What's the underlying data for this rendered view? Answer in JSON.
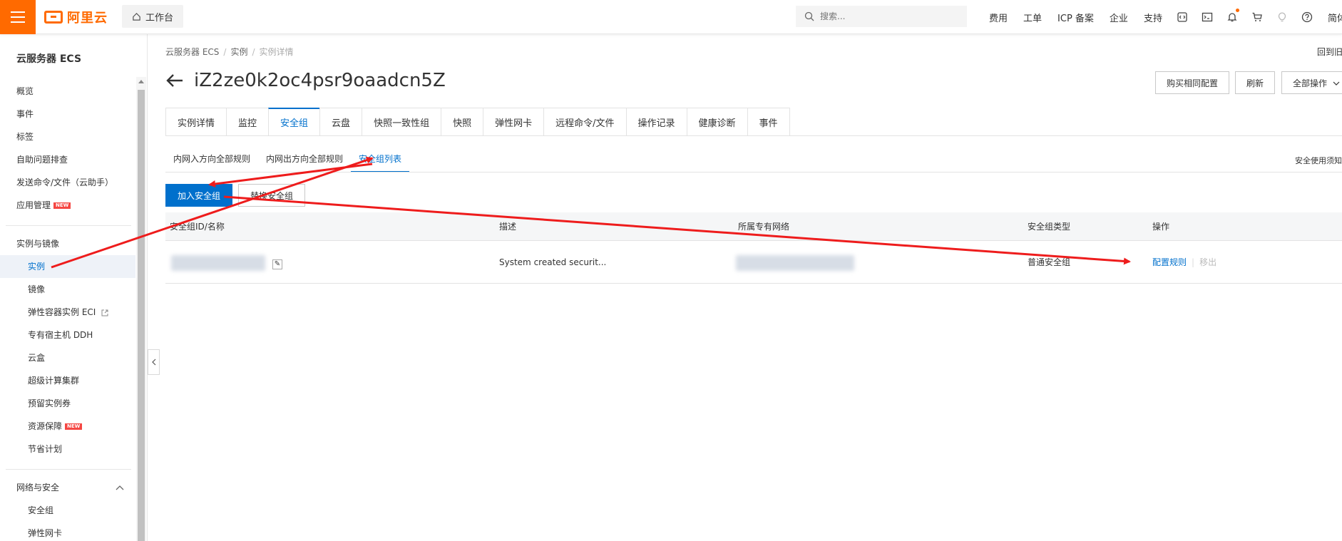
{
  "topbar": {
    "logo_text": "阿里云",
    "workbench": "工作台",
    "search_placeholder": "搜索...",
    "nav": [
      "费用",
      "工单",
      "ICP 备案",
      "企业",
      "支持"
    ],
    "icons": [
      "code-icon",
      "terminal-icon",
      "bell-icon",
      "cart-icon",
      "lightbulb-icon",
      "help-icon"
    ],
    "language": "简体"
  },
  "sidebar": {
    "title": "云服务器 ECS",
    "items": [
      "概览",
      "事件",
      "标签",
      "自助问题排查",
      "发送命令/文件（云助手）",
      "应用管理"
    ],
    "new_badge": "NEW",
    "group1": {
      "label": "实例与镜像",
      "items": [
        "实例",
        "镜像",
        "弹性容器实例 ECI",
        "专有宿主机 DDH",
        "云盒",
        "超级计算集群",
        "预留实例券",
        "资源保障",
        "节省计划"
      ]
    },
    "group2": {
      "label": "网络与安全",
      "items": [
        "安全组",
        "弹性网卡"
      ]
    }
  },
  "breadcrumb": [
    "云服务器 ECS",
    "实例",
    "实例详情"
  ],
  "back_link": "回到旧",
  "page_title": "iZ2ze0k2oc4psr9oaadcn5Z",
  "header_buttons": {
    "buy_same": "购买相同配置",
    "refresh": "刷新",
    "all_ops": "全部操作"
  },
  "tabs": [
    "实例详情",
    "监控",
    "安全组",
    "云盘",
    "快照一致性组",
    "快照",
    "弹性网卡",
    "远程命令/文件",
    "操作记录",
    "健康诊断",
    "事件"
  ],
  "active_tab": "安全组",
  "subtabs": [
    "内网入方向全部规则",
    "内网出方向全部规则",
    "安全组列表"
  ],
  "sec_note": "安全使用须知",
  "actions": {
    "add": "加入安全组",
    "replace": "替换安全组"
  },
  "table": {
    "headers": [
      "安全组ID/名称",
      "描述",
      "所属专有网络",
      "安全组类型",
      "操作"
    ],
    "rows": [
      {
        "description": "System created securit...",
        "type": "普通安全组",
        "op_config": "配置规则",
        "op_remove": "移出"
      }
    ]
  },
  "colors": {
    "brand": "#ff6a00",
    "primary": "#0070cc",
    "annotation_arrow": "#ee1c1c"
  }
}
